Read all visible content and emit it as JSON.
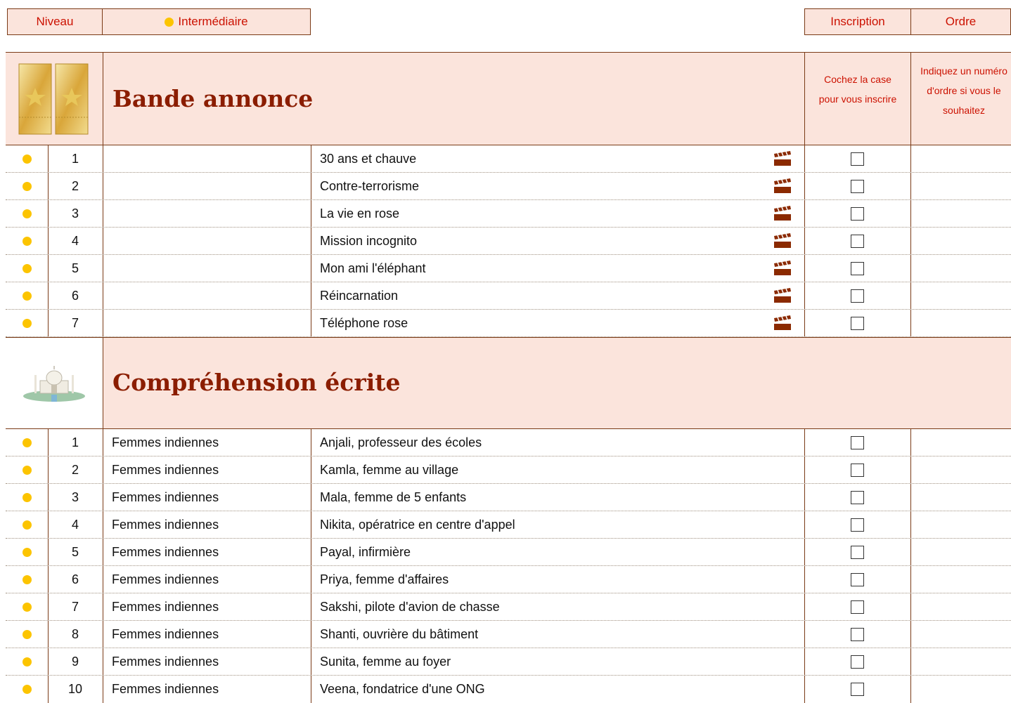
{
  "topbar": {
    "level_label": "Niveau",
    "level_value": "Intermédiaire",
    "inscription_label": "Inscription",
    "order_label": "Ordre"
  },
  "colors": {
    "accent": "#cc1100",
    "header_bg": "#fbe4dc",
    "border": "#7a3a16",
    "dot": "#fcc400",
    "title": "#8b1d00"
  },
  "sections": [
    {
      "title": "Bande annonce",
      "icon": "cinema-tickets-icon",
      "check_note": "Cochez la case pour vous inscrire",
      "order_note": "Indiquez un numéro d'ordre si vous le souhaitez",
      "rows": [
        {
          "num": "1",
          "category": "",
          "title": "30 ans et chauve",
          "has_video": true
        },
        {
          "num": "2",
          "category": "",
          "title": "Contre-terrorisme",
          "has_video": true
        },
        {
          "num": "3",
          "category": "",
          "title": "La vie en rose",
          "has_video": true
        },
        {
          "num": "4",
          "category": "",
          "title": "Mission incognito",
          "has_video": true
        },
        {
          "num": "5",
          "category": "",
          "title": "Mon ami l'éléphant",
          "has_video": true
        },
        {
          "num": "6",
          "category": "",
          "title": "Réincarnation",
          "has_video": true
        },
        {
          "num": "7",
          "category": "",
          "title": "Téléphone rose",
          "has_video": true
        }
      ]
    },
    {
      "title": "Compréhension écrite",
      "icon": "taj-mahal-icon",
      "rows": [
        {
          "num": "1",
          "category": "Femmes indiennes",
          "title": "Anjali, professeur des écoles"
        },
        {
          "num": "2",
          "category": "Femmes indiennes",
          "title": "Kamla, femme au village"
        },
        {
          "num": "3",
          "category": "Femmes indiennes",
          "title": "Mala, femme de 5 enfants"
        },
        {
          "num": "4",
          "category": "Femmes indiennes",
          "title": "Nikita, opératrice en centre d'appel"
        },
        {
          "num": "5",
          "category": "Femmes indiennes",
          "title": "Payal, infirmière"
        },
        {
          "num": "6",
          "category": "Femmes indiennes",
          "title": "Priya, femme d'affaires"
        },
        {
          "num": "7",
          "category": "Femmes indiennes",
          "title": "Sakshi, pilote d'avion de chasse"
        },
        {
          "num": "8",
          "category": "Femmes indiennes",
          "title": "Shanti, ouvrière du bâtiment"
        },
        {
          "num": "9",
          "category": "Femmes indiennes",
          "title": "Sunita, femme au foyer"
        },
        {
          "num": "10",
          "category": "Femmes indiennes",
          "title": "Veena, fondatrice d'une ONG"
        }
      ]
    }
  ]
}
